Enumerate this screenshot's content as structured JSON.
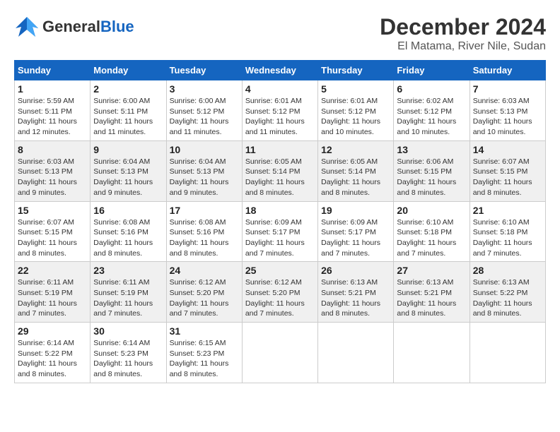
{
  "header": {
    "logo": {
      "general": "General",
      "blue": "Blue"
    },
    "title": "December 2024",
    "location": "El Matama, River Nile, Sudan"
  },
  "days_of_week": [
    "Sunday",
    "Monday",
    "Tuesday",
    "Wednesday",
    "Thursday",
    "Friday",
    "Saturday"
  ],
  "weeks": [
    [
      {
        "day": "1",
        "info": "Sunrise: 5:59 AM\nSunset: 5:11 PM\nDaylight: 11 hours and 12 minutes."
      },
      {
        "day": "2",
        "info": "Sunrise: 6:00 AM\nSunset: 5:11 PM\nDaylight: 11 hours and 11 minutes."
      },
      {
        "day": "3",
        "info": "Sunrise: 6:00 AM\nSunset: 5:12 PM\nDaylight: 11 hours and 11 minutes."
      },
      {
        "day": "4",
        "info": "Sunrise: 6:01 AM\nSunset: 5:12 PM\nDaylight: 11 hours and 11 minutes."
      },
      {
        "day": "5",
        "info": "Sunrise: 6:01 AM\nSunset: 5:12 PM\nDaylight: 11 hours and 10 minutes."
      },
      {
        "day": "6",
        "info": "Sunrise: 6:02 AM\nSunset: 5:12 PM\nDaylight: 11 hours and 10 minutes."
      },
      {
        "day": "7",
        "info": "Sunrise: 6:03 AM\nSunset: 5:13 PM\nDaylight: 11 hours and 10 minutes."
      }
    ],
    [
      {
        "day": "8",
        "info": "Sunrise: 6:03 AM\nSunset: 5:13 PM\nDaylight: 11 hours and 9 minutes."
      },
      {
        "day": "9",
        "info": "Sunrise: 6:04 AM\nSunset: 5:13 PM\nDaylight: 11 hours and 9 minutes."
      },
      {
        "day": "10",
        "info": "Sunrise: 6:04 AM\nSunset: 5:13 PM\nDaylight: 11 hours and 9 minutes."
      },
      {
        "day": "11",
        "info": "Sunrise: 6:05 AM\nSunset: 5:14 PM\nDaylight: 11 hours and 8 minutes."
      },
      {
        "day": "12",
        "info": "Sunrise: 6:05 AM\nSunset: 5:14 PM\nDaylight: 11 hours and 8 minutes."
      },
      {
        "day": "13",
        "info": "Sunrise: 6:06 AM\nSunset: 5:15 PM\nDaylight: 11 hours and 8 minutes."
      },
      {
        "day": "14",
        "info": "Sunrise: 6:07 AM\nSunset: 5:15 PM\nDaylight: 11 hours and 8 minutes."
      }
    ],
    [
      {
        "day": "15",
        "info": "Sunrise: 6:07 AM\nSunset: 5:15 PM\nDaylight: 11 hours and 8 minutes."
      },
      {
        "day": "16",
        "info": "Sunrise: 6:08 AM\nSunset: 5:16 PM\nDaylight: 11 hours and 8 minutes."
      },
      {
        "day": "17",
        "info": "Sunrise: 6:08 AM\nSunset: 5:16 PM\nDaylight: 11 hours and 8 minutes."
      },
      {
        "day": "18",
        "info": "Sunrise: 6:09 AM\nSunset: 5:17 PM\nDaylight: 11 hours and 7 minutes."
      },
      {
        "day": "19",
        "info": "Sunrise: 6:09 AM\nSunset: 5:17 PM\nDaylight: 11 hours and 7 minutes."
      },
      {
        "day": "20",
        "info": "Sunrise: 6:10 AM\nSunset: 5:18 PM\nDaylight: 11 hours and 7 minutes."
      },
      {
        "day": "21",
        "info": "Sunrise: 6:10 AM\nSunset: 5:18 PM\nDaylight: 11 hours and 7 minutes."
      }
    ],
    [
      {
        "day": "22",
        "info": "Sunrise: 6:11 AM\nSunset: 5:19 PM\nDaylight: 11 hours and 7 minutes."
      },
      {
        "day": "23",
        "info": "Sunrise: 6:11 AM\nSunset: 5:19 PM\nDaylight: 11 hours and 7 minutes."
      },
      {
        "day": "24",
        "info": "Sunrise: 6:12 AM\nSunset: 5:20 PM\nDaylight: 11 hours and 7 minutes."
      },
      {
        "day": "25",
        "info": "Sunrise: 6:12 AM\nSunset: 5:20 PM\nDaylight: 11 hours and 7 minutes."
      },
      {
        "day": "26",
        "info": "Sunrise: 6:13 AM\nSunset: 5:21 PM\nDaylight: 11 hours and 8 minutes."
      },
      {
        "day": "27",
        "info": "Sunrise: 6:13 AM\nSunset: 5:21 PM\nDaylight: 11 hours and 8 minutes."
      },
      {
        "day": "28",
        "info": "Sunrise: 6:13 AM\nSunset: 5:22 PM\nDaylight: 11 hours and 8 minutes."
      }
    ],
    [
      {
        "day": "29",
        "info": "Sunrise: 6:14 AM\nSunset: 5:22 PM\nDaylight: 11 hours and 8 minutes."
      },
      {
        "day": "30",
        "info": "Sunrise: 6:14 AM\nSunset: 5:23 PM\nDaylight: 11 hours and 8 minutes."
      },
      {
        "day": "31",
        "info": "Sunrise: 6:15 AM\nSunset: 5:23 PM\nDaylight: 11 hours and 8 minutes."
      },
      {
        "day": "",
        "info": ""
      },
      {
        "day": "",
        "info": ""
      },
      {
        "day": "",
        "info": ""
      },
      {
        "day": "",
        "info": ""
      }
    ]
  ]
}
